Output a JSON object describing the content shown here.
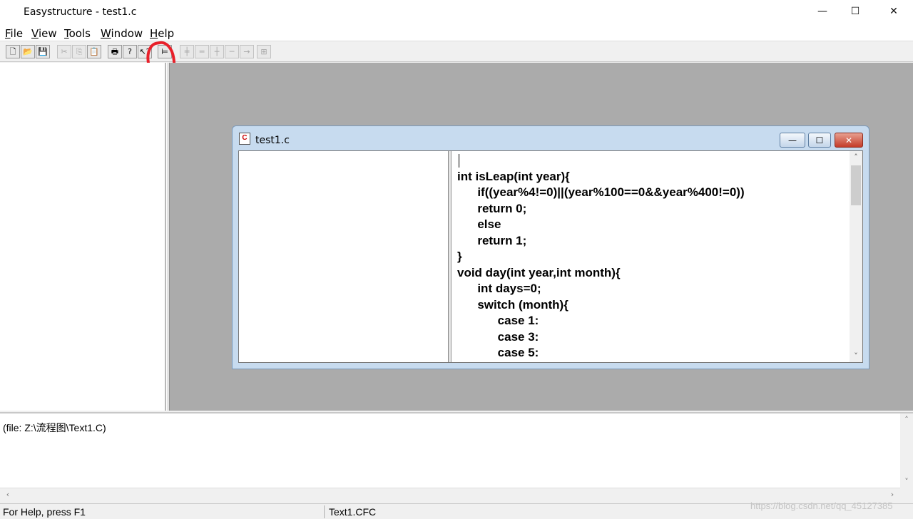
{
  "app": {
    "title": "Easystructure - test1.c",
    "window_controls": {
      "minimize": "—",
      "maximize": "☐",
      "close": "✕"
    }
  },
  "menu": {
    "file": {
      "accel": "F",
      "rest": "ile"
    },
    "view": {
      "accel": "V",
      "rest": "iew"
    },
    "tools": {
      "accel": "T",
      "rest": "ools"
    },
    "window": {
      "accel": "W",
      "rest": "indow"
    },
    "help": {
      "accel": "H",
      "rest": "elp"
    }
  },
  "toolbar": {
    "new": "🗋",
    "open": "📂",
    "save": "💾",
    "cut": "✂",
    "copy": "⎘",
    "paste": "📋",
    "print": "🖶",
    "about": "?",
    "context_help": "↖?",
    "structure": "⊨",
    "sequence": "╪",
    "selection": "═",
    "iteration": "┼",
    "branch": "─",
    "jump": "→",
    "group": "⊞"
  },
  "child_window": {
    "title": "test1.c",
    "icon": "C",
    "controls": {
      "minimize": "—",
      "maximize": "☐",
      "close": "✕"
    },
    "code_lines": [
      "",
      "int isLeap(int year){",
      "      if((year%4!=0)||(year%100==0&&year%400!=0))",
      "      return 0;",
      "      else",
      "      return 1;",
      "}",
      "void day(int year,int month){",
      "      int days=0;",
      "      switch (month){",
      "            case 1:",
      "            case 3:",
      "            case 5:"
    ],
    "scroll_up": "˄",
    "scroll_down": "˅"
  },
  "output": {
    "text": "(file: Z:\\流程图\\Text1.C)",
    "scroll_up": "˄",
    "scroll_down": "˅",
    "scroll_left": "‹",
    "scroll_right": "›"
  },
  "status": {
    "help": "For Help, press F1",
    "file": "Text1.CFC"
  },
  "watermark": "https://blog.csdn.net/qq_45127385"
}
